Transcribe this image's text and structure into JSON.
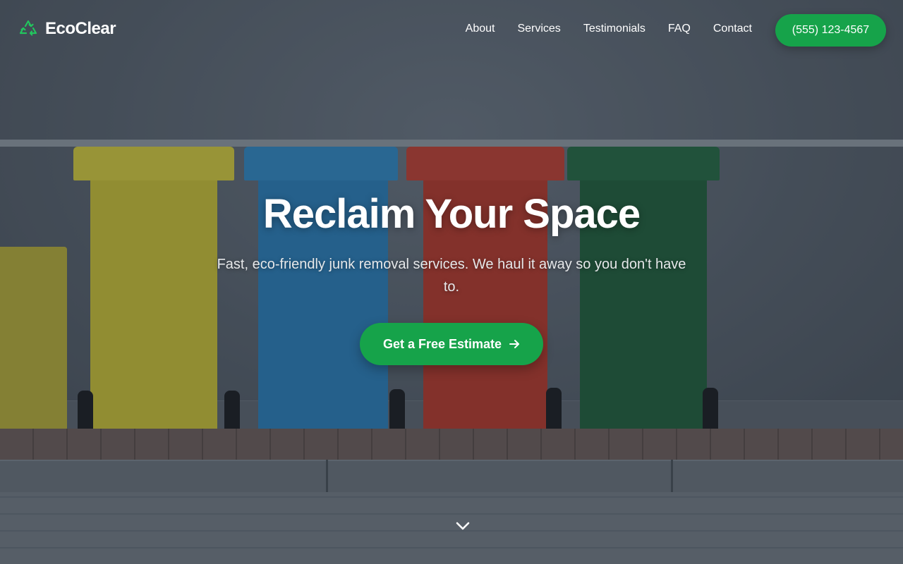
{
  "brand": {
    "name": "EcoClear",
    "icon": "recycle-icon",
    "accent": "#16a34a"
  },
  "nav": {
    "items": [
      {
        "label": "About"
      },
      {
        "label": "Services"
      },
      {
        "label": "Testimonials"
      },
      {
        "label": "FAQ"
      },
      {
        "label": "Contact"
      }
    ],
    "phone_label": "(555) 123-4567"
  },
  "hero": {
    "title": "Reclaim Your Space",
    "subtitle": "Fast, eco-friendly junk removal services. We haul it away so you don't have to.",
    "cta_label": "Get a Free Estimate",
    "cta_icon": "arrow-right-icon",
    "scroll_icon": "chevron-down-icon",
    "background": "photo of yellow, blue, red and green waste bins against a wall"
  }
}
